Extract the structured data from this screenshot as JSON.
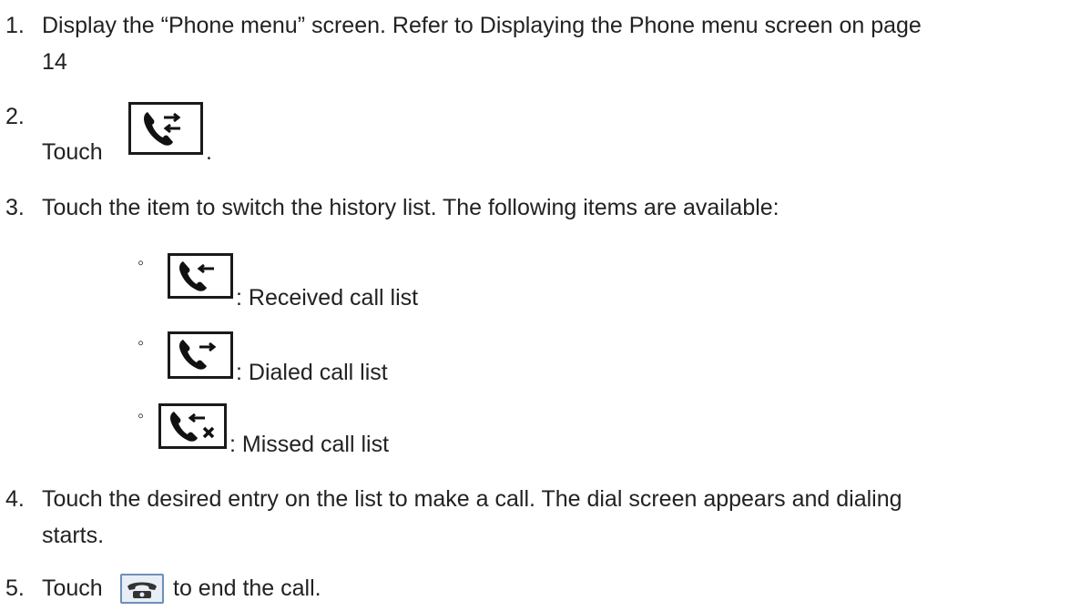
{
  "steps": [
    {
      "number": "1.",
      "text_line1": "Display the “Phone menu” screen. Refer to Displaying the Phone menu screen on page",
      "text_line2": "14"
    },
    {
      "number": "2.",
      "text": "Touch",
      "trailing": "."
    },
    {
      "number": "3.",
      "text": "Touch the item to switch the history list. The following items are available:"
    },
    {
      "number": "4.",
      "text_line1": "Touch the desired entry on the list to make a call. The dial screen appears and dialing",
      "text_line2": "starts."
    },
    {
      "number": "5.",
      "text_before": "Touch",
      "text_after": "to end the call."
    }
  ],
  "history_items": [
    {
      "bullet": "◦",
      "icon": "received-call-icon",
      "label": ": Received call list"
    },
    {
      "bullet": "◦",
      "icon": "dialed-call-icon",
      "label": ": Dialed call list"
    },
    {
      "bullet": "◦",
      "icon": "missed-call-icon",
      "label": ": Missed call list"
    }
  ],
  "icons": {
    "history": "call-history-icon",
    "end_call": "end-call-icon"
  },
  "colors": {
    "text": "#222222",
    "icon_border": "#1a1a1a",
    "end_call_border": "#6d8fb8"
  }
}
